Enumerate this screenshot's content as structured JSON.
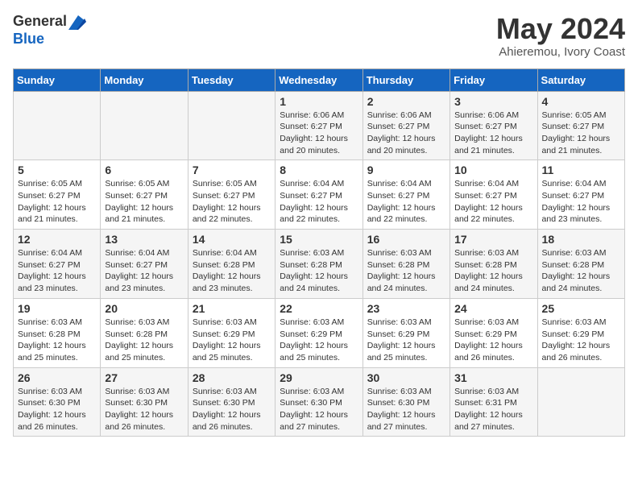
{
  "header": {
    "logo_line1": "General",
    "logo_line2": "Blue",
    "month_title": "May 2024",
    "location": "Ahieremou, Ivory Coast"
  },
  "weekdays": [
    "Sunday",
    "Monday",
    "Tuesday",
    "Wednesday",
    "Thursday",
    "Friday",
    "Saturday"
  ],
  "weeks": [
    [
      {
        "day": "",
        "info": ""
      },
      {
        "day": "",
        "info": ""
      },
      {
        "day": "",
        "info": ""
      },
      {
        "day": "1",
        "info": "Sunrise: 6:06 AM\nSunset: 6:27 PM\nDaylight: 12 hours\nand 20 minutes."
      },
      {
        "day": "2",
        "info": "Sunrise: 6:06 AM\nSunset: 6:27 PM\nDaylight: 12 hours\nand 20 minutes."
      },
      {
        "day": "3",
        "info": "Sunrise: 6:06 AM\nSunset: 6:27 PM\nDaylight: 12 hours\nand 21 minutes."
      },
      {
        "day": "4",
        "info": "Sunrise: 6:05 AM\nSunset: 6:27 PM\nDaylight: 12 hours\nand 21 minutes."
      }
    ],
    [
      {
        "day": "5",
        "info": "Sunrise: 6:05 AM\nSunset: 6:27 PM\nDaylight: 12 hours\nand 21 minutes."
      },
      {
        "day": "6",
        "info": "Sunrise: 6:05 AM\nSunset: 6:27 PM\nDaylight: 12 hours\nand 21 minutes."
      },
      {
        "day": "7",
        "info": "Sunrise: 6:05 AM\nSunset: 6:27 PM\nDaylight: 12 hours\nand 22 minutes."
      },
      {
        "day": "8",
        "info": "Sunrise: 6:04 AM\nSunset: 6:27 PM\nDaylight: 12 hours\nand 22 minutes."
      },
      {
        "day": "9",
        "info": "Sunrise: 6:04 AM\nSunset: 6:27 PM\nDaylight: 12 hours\nand 22 minutes."
      },
      {
        "day": "10",
        "info": "Sunrise: 6:04 AM\nSunset: 6:27 PM\nDaylight: 12 hours\nand 22 minutes."
      },
      {
        "day": "11",
        "info": "Sunrise: 6:04 AM\nSunset: 6:27 PM\nDaylight: 12 hours\nand 23 minutes."
      }
    ],
    [
      {
        "day": "12",
        "info": "Sunrise: 6:04 AM\nSunset: 6:27 PM\nDaylight: 12 hours\nand 23 minutes."
      },
      {
        "day": "13",
        "info": "Sunrise: 6:04 AM\nSunset: 6:27 PM\nDaylight: 12 hours\nand 23 minutes."
      },
      {
        "day": "14",
        "info": "Sunrise: 6:04 AM\nSunset: 6:28 PM\nDaylight: 12 hours\nand 23 minutes."
      },
      {
        "day": "15",
        "info": "Sunrise: 6:03 AM\nSunset: 6:28 PM\nDaylight: 12 hours\nand 24 minutes."
      },
      {
        "day": "16",
        "info": "Sunrise: 6:03 AM\nSunset: 6:28 PM\nDaylight: 12 hours\nand 24 minutes."
      },
      {
        "day": "17",
        "info": "Sunrise: 6:03 AM\nSunset: 6:28 PM\nDaylight: 12 hours\nand 24 minutes."
      },
      {
        "day": "18",
        "info": "Sunrise: 6:03 AM\nSunset: 6:28 PM\nDaylight: 12 hours\nand 24 minutes."
      }
    ],
    [
      {
        "day": "19",
        "info": "Sunrise: 6:03 AM\nSunset: 6:28 PM\nDaylight: 12 hours\nand 25 minutes."
      },
      {
        "day": "20",
        "info": "Sunrise: 6:03 AM\nSunset: 6:28 PM\nDaylight: 12 hours\nand 25 minutes."
      },
      {
        "day": "21",
        "info": "Sunrise: 6:03 AM\nSunset: 6:29 PM\nDaylight: 12 hours\nand 25 minutes."
      },
      {
        "day": "22",
        "info": "Sunrise: 6:03 AM\nSunset: 6:29 PM\nDaylight: 12 hours\nand 25 minutes."
      },
      {
        "day": "23",
        "info": "Sunrise: 6:03 AM\nSunset: 6:29 PM\nDaylight: 12 hours\nand 25 minutes."
      },
      {
        "day": "24",
        "info": "Sunrise: 6:03 AM\nSunset: 6:29 PM\nDaylight: 12 hours\nand 26 minutes."
      },
      {
        "day": "25",
        "info": "Sunrise: 6:03 AM\nSunset: 6:29 PM\nDaylight: 12 hours\nand 26 minutes."
      }
    ],
    [
      {
        "day": "26",
        "info": "Sunrise: 6:03 AM\nSunset: 6:30 PM\nDaylight: 12 hours\nand 26 minutes."
      },
      {
        "day": "27",
        "info": "Sunrise: 6:03 AM\nSunset: 6:30 PM\nDaylight: 12 hours\nand 26 minutes."
      },
      {
        "day": "28",
        "info": "Sunrise: 6:03 AM\nSunset: 6:30 PM\nDaylight: 12 hours\nand 26 minutes."
      },
      {
        "day": "29",
        "info": "Sunrise: 6:03 AM\nSunset: 6:30 PM\nDaylight: 12 hours\nand 27 minutes."
      },
      {
        "day": "30",
        "info": "Sunrise: 6:03 AM\nSunset: 6:30 PM\nDaylight: 12 hours\nand 27 minutes."
      },
      {
        "day": "31",
        "info": "Sunrise: 6:03 AM\nSunset: 6:31 PM\nDaylight: 12 hours\nand 27 minutes."
      },
      {
        "day": "",
        "info": ""
      }
    ]
  ]
}
